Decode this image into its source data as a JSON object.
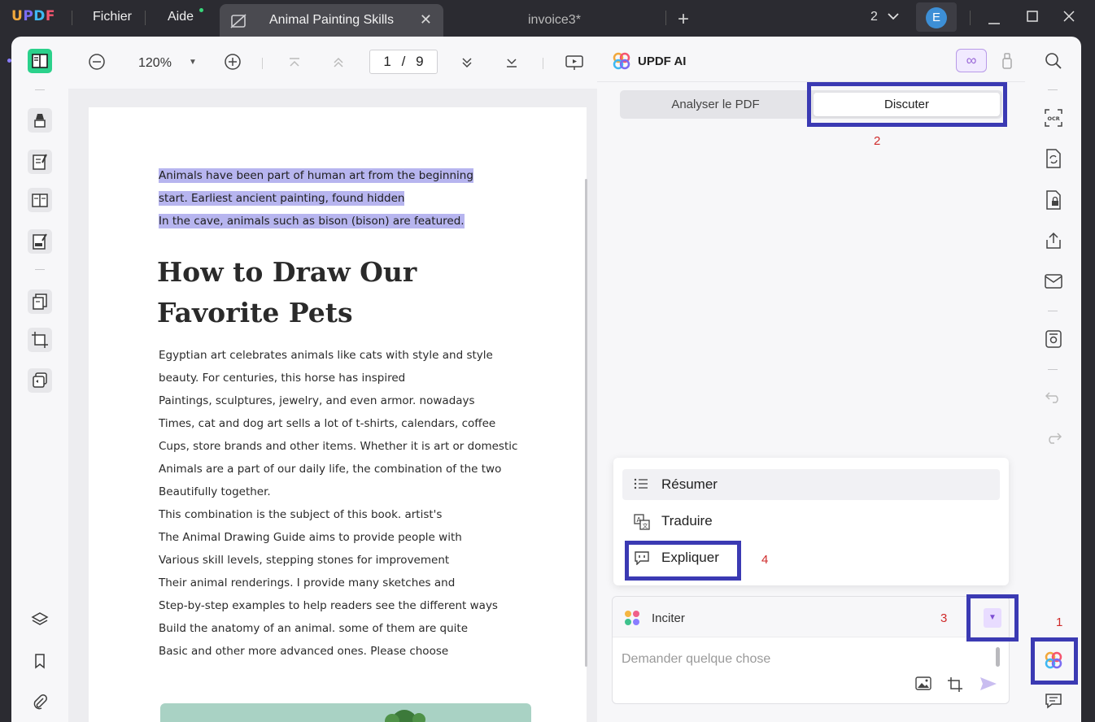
{
  "app": {
    "logo": "UPDF",
    "logo_colors": [
      "#f1a83c",
      "#7a6cf2",
      "#3fb8f2",
      "#f5556f"
    ],
    "menu": {
      "file": "Fichier",
      "help": "Aide"
    },
    "tabs": [
      {
        "title": "Animal Painting Skills",
        "active": true
      },
      {
        "title": "invoice3*",
        "active": false
      }
    ],
    "window_count": "2",
    "avatar_letter": "E"
  },
  "doc_toolbar": {
    "zoom": "120%",
    "page_current": "1",
    "page_separator": "/",
    "page_total": "9"
  },
  "document": {
    "highlighted_lines": [
      "Animals have been part of human art from the beginning",
      "start. Earliest ancient painting, found hidden",
      "In the cave, animals such as bison (bison) are featured."
    ],
    "heading_lines": [
      "How to Draw Our",
      "Favorite Pets"
    ],
    "paragraph_lines": [
      "Egyptian art celebrates animals like cats with style and style",
      "beauty. For centuries, this horse has inspired",
      "Paintings, sculptures, jewelry, and even armor. nowadays",
      "Times, cat and dog art sells a lot of t-shirts, calendars, coffee",
      "Cups, store brands and other items. Whether it is art or domestic",
      "Animals are a part of our daily life, the combination of the two",
      "Beautifully together.",
      "This combination is the subject of this book. artist's",
      "The Animal Drawing Guide aims to provide people with",
      "Various skill levels, stepping stones for improvement",
      "Their animal renderings. I provide many sketches and",
      "Step-by-step examples to help readers see the different ways",
      "Build the anatomy of an animal. some of them are quite",
      "Basic and other more advanced ones. Please choose"
    ],
    "highlight_color": "#b7b5ef"
  },
  "ai_panel": {
    "title": "UPDF AI",
    "mode_tabs": [
      "Analyser le PDF",
      "Discuter"
    ],
    "active_mode": "Discuter",
    "prompt_menu": [
      "Résumer",
      "Traduire",
      "Expliquer"
    ],
    "prompt_label": "Inciter",
    "input_placeholder": "Demander quelque chose",
    "accent": "#7d4ed3"
  },
  "annotations": {
    "box_color": "#3b3ab3",
    "number_color": "#cf2a2a",
    "labels": [
      "1",
      "2",
      "3",
      "4"
    ]
  }
}
